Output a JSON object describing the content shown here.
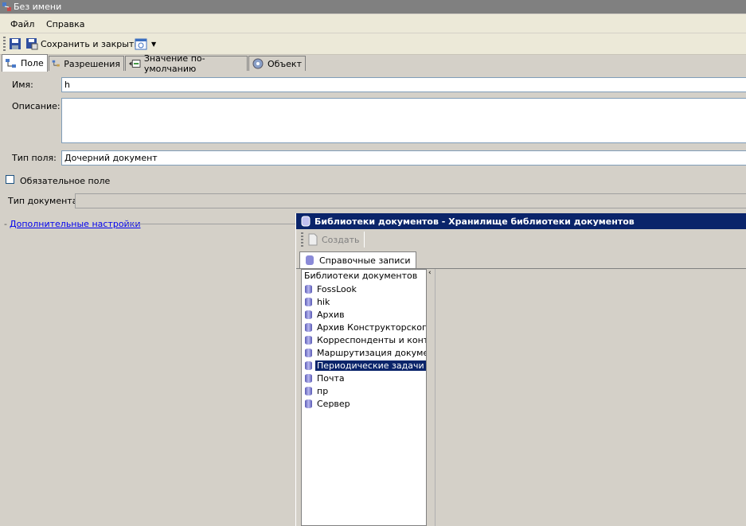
{
  "window": {
    "title": "Без имени"
  },
  "menu": {
    "items": [
      "Файл",
      "Справка"
    ]
  },
  "toolbar": {
    "save_close_label": "Сохранить и закрыть"
  },
  "tabs": [
    {
      "label": "Поле",
      "active": true
    },
    {
      "label": "Разрешения",
      "active": false
    },
    {
      "label": "Значение по-умолчанию",
      "active": false
    },
    {
      "label": "Объект",
      "active": false
    }
  ],
  "form": {
    "name_label": "Имя:",
    "name_value": "h",
    "description_label": "Описание:",
    "description_value": "",
    "field_type_label": "Тип поля:",
    "field_type_value": "Дочерний документ",
    "required_label": "Обязательное поле",
    "required_checked": false,
    "doc_type_label": "Тип документа:",
    "doc_type_value": "",
    "advanced_link": "Дополнительные настройки"
  },
  "library_window": {
    "title": "Библиотеки документов - Хранилище библиотеки документов",
    "create_label": "Создать",
    "tab_label": "Справочные записи",
    "tree_header": "Библиотеки документов",
    "items": [
      {
        "label": "FossLook",
        "selected": false
      },
      {
        "label": "hik",
        "selected": false
      },
      {
        "label": "Архив",
        "selected": false
      },
      {
        "label": "Архив Конструкторского б",
        "selected": false
      },
      {
        "label": "Корреспонденты и контак",
        "selected": false
      },
      {
        "label": "Маршрутизация документ",
        "selected": false
      },
      {
        "label": "Периодические задачи",
        "selected": true
      },
      {
        "label": "Почта",
        "selected": false
      },
      {
        "label": "пр",
        "selected": false
      },
      {
        "label": "Сервер",
        "selected": false
      }
    ]
  },
  "colors": {
    "title_active": "#0a246a",
    "title_inactive": "#808080",
    "link": "#0000ee"
  }
}
